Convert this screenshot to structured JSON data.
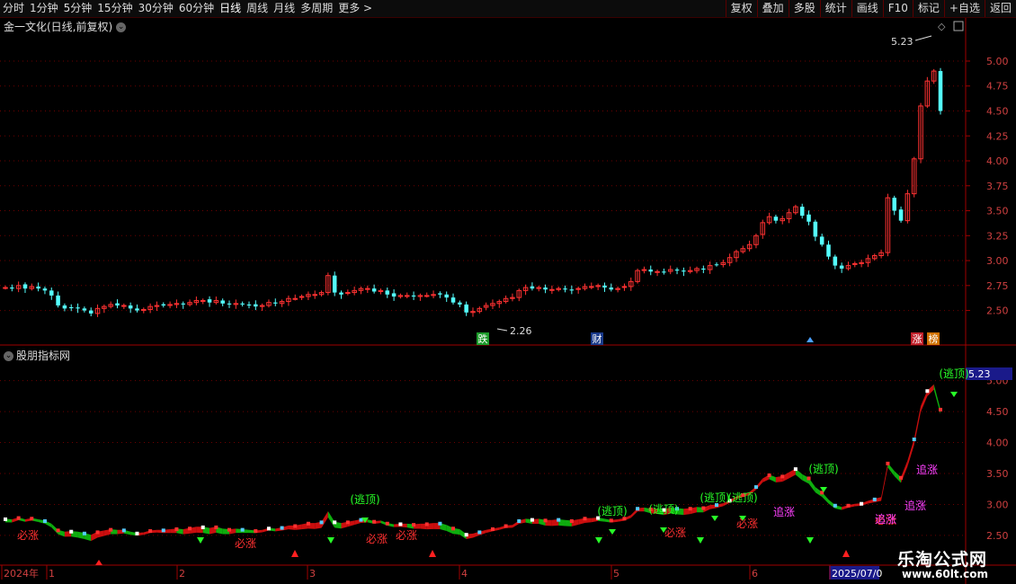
{
  "toolbar": {
    "periods": [
      "分时",
      "1分钟",
      "5分钟",
      "15分钟",
      "30分钟",
      "60分钟",
      "日线",
      "周线",
      "月线",
      "多周期",
      "更多 >"
    ],
    "active_period": "日线",
    "right_items": [
      "复权",
      "叠加",
      "多股",
      "统计",
      "画线",
      "F10",
      "标记",
      "+自选",
      "返回"
    ]
  },
  "chart": {
    "title": "金一文化(日线,前复权)",
    "indicator_title": "股朋指标网",
    "colors": {
      "up": "#ff3232",
      "down": "#54ffff",
      "grid": "#6e0000",
      "axis": "#a00000"
    }
  },
  "chart_data": [
    {
      "type": "candlestick",
      "title": "金一文化(日线,前复权)",
      "y_ticks": [
        "5.00",
        "4.75",
        "4.50",
        "4.25",
        "4.00",
        "3.75",
        "3.50",
        "3.25",
        "3.00",
        "2.75",
        "2.50"
      ],
      "ylim": [
        2.37,
        5.27
      ],
      "high_label": "5.23",
      "low_label": "2.26",
      "markers": [
        "跌",
        "财",
        "涨",
        "榜"
      ],
      "closes": [
        2.73,
        2.72,
        2.75,
        2.72,
        2.74,
        2.72,
        2.7,
        2.65,
        2.55,
        2.52,
        2.53,
        2.52,
        2.5,
        2.47,
        2.52,
        2.54,
        2.56,
        2.55,
        2.55,
        2.52,
        2.5,
        2.51,
        2.54,
        2.55,
        2.55,
        2.56,
        2.57,
        2.56,
        2.58,
        2.6,
        2.6,
        2.58,
        2.6,
        2.57,
        2.56,
        2.57,
        2.56,
        2.55,
        2.54,
        2.55,
        2.58,
        2.57,
        2.59,
        2.62,
        2.62,
        2.64,
        2.66,
        2.66,
        2.68,
        2.85,
        2.68,
        2.66,
        2.68,
        2.7,
        2.72,
        2.72,
        2.69,
        2.7,
        2.66,
        2.64,
        2.65,
        2.65,
        2.64,
        2.65,
        2.65,
        2.66,
        2.66,
        2.63,
        2.58,
        2.56,
        2.48,
        2.49,
        2.52,
        2.55,
        2.57,
        2.59,
        2.62,
        2.63,
        2.7,
        2.73,
        2.72,
        2.73,
        2.71,
        2.71,
        2.72,
        2.71,
        2.7,
        2.72,
        2.74,
        2.74,
        2.75,
        2.73,
        2.71,
        2.72,
        2.74,
        2.79,
        2.9,
        2.91,
        2.89,
        2.89,
        2.88,
        2.91,
        2.9,
        2.89,
        2.9,
        2.92,
        2.91,
        2.95,
        2.96,
        2.98,
        3.03,
        3.09,
        3.12,
        3.16,
        3.25,
        3.38,
        3.44,
        3.4,
        3.42,
        3.48,
        3.54,
        3.45,
        3.39,
        3.24,
        3.16,
        3.04,
        2.95,
        2.92,
        2.95,
        2.97,
        2.98,
        3.02,
        3.05,
        3.08,
        3.63,
        3.5,
        3.4,
        3.67,
        4.02,
        4.55,
        4.8,
        4.9,
        4.5
      ],
      "volume_style_note": ""
    },
    {
      "type": "indicator",
      "title": "股朋指标网",
      "y_ticks": [
        "5.00",
        "4.50",
        "4.00",
        "3.50",
        "3.00",
        "2.50"
      ],
      "value_label": "5.23",
      "signal_labels": [
        "逃顶",
        "逃顶",
        "逃顶",
        "逃顶",
        "逃顶",
        "逃顶",
        "逃顶"
      ],
      "buy_labels": [
        "必涨",
        "必涨",
        "必涨",
        "必涨",
        "必涨",
        "必涨",
        "必涨"
      ],
      "chase_labels": [
        "追涨",
        "追涨",
        "追涨",
        "追涨"
      ],
      "x_labels": [
        "2024年",
        "1",
        "2",
        "3",
        "4",
        "5",
        "6",
        "2025/07/0"
      ]
    }
  ],
  "watermark": {
    "name": "乐淘公式网",
    "url": "www.60lt.com"
  }
}
